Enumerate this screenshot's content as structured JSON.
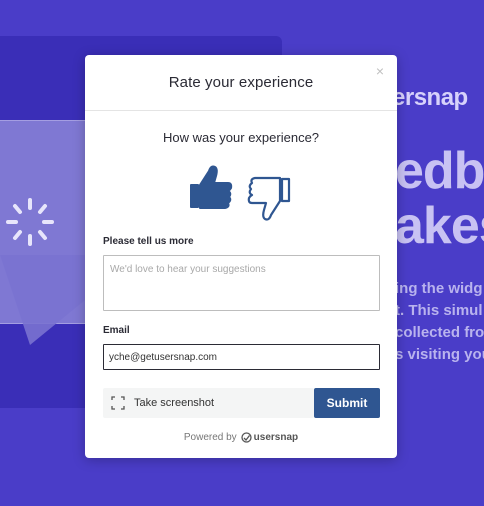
{
  "background": {
    "logo_text": "ersnap",
    "hero_line1": "edb",
    "hero_line2": "akes",
    "body_lines": [
      "ing the widg",
      "t. This simul",
      "collected fro",
      "s visiting you"
    ]
  },
  "widget": {
    "title": "Rate your experience",
    "close_label": "×",
    "question": "How was your experience?",
    "rating_options": [
      "thumbs-up",
      "thumbs-down"
    ],
    "feedback_label": "Please tell us more",
    "feedback_placeholder": "We'd love to hear your suggestions",
    "feedback_value": "",
    "email_label": "Email",
    "email_value": "yche@getusersnap.com",
    "screenshot_label": "Take screenshot",
    "submit_label": "Submit",
    "powered_by": "Powered by",
    "brand_name": "usersnap"
  },
  "colors": {
    "page_bg": "#4a3dc8",
    "accent_submit": "#2f5691",
    "thumb_icon": "#2f5691"
  }
}
